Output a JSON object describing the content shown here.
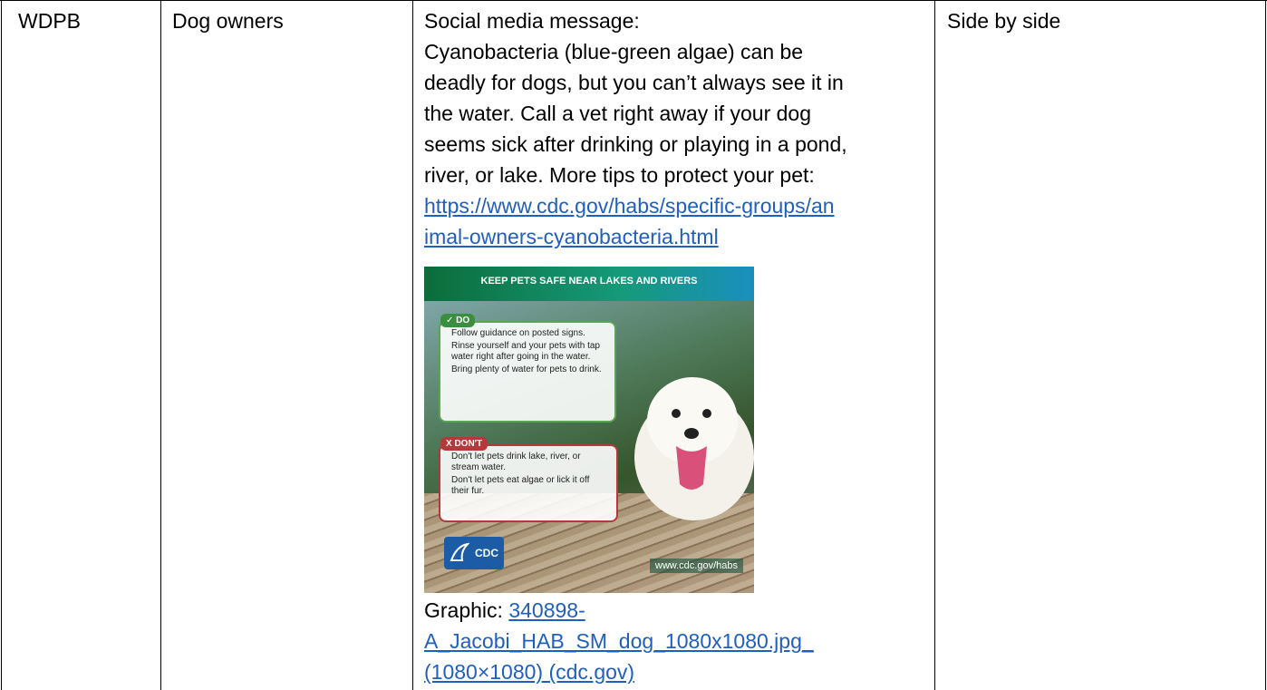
{
  "row": {
    "organization": "WDPB",
    "audience": "Dog owners",
    "message": {
      "lines": [
        "Social media message:",
        "Cyanobacteria (blue-green algae) can be",
        "deadly for dogs, but you can’t always see it in",
        "the water. Call a vet right away if your dog",
        "seems sick after drinking or playing in a pond,",
        "river, or lake. More tips to protect your pet:"
      ],
      "link_lines": [
        "https://www.cdc.gov/habs/specific-groups/an",
        "imal-owners-cyanobacteria.html"
      ],
      "graphic": {
        "banner": "KEEP PETS SAFE NEAR LAKES AND RIVERS",
        "do_label": "✓ DO",
        "do_items": [
          "Follow guidance on posted signs.",
          "Rinse yourself and your pets with tap water right after going in the water.",
          "Bring plenty of water for pets to drink."
        ],
        "dont_label": "X DON'T",
        "dont_items": [
          "Don't let pets drink lake, river, or stream water.",
          "Don't let pets eat algae or lick it off their fur."
        ],
        "logo": "CDC",
        "url": "www.cdc.gov/habs"
      },
      "caption_prefix": "Graphic: ",
      "caption_link_lines": [
        "340898-",
        "A_Jacobi_HAB_SM_dog_1080x1080.jpg_",
        "(1080×1080) (cdc.gov)"
      ]
    },
    "format": "Side by side"
  }
}
